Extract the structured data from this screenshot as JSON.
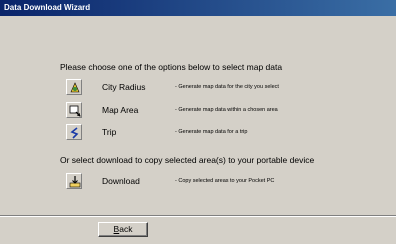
{
  "window": {
    "title": "Data Download Wizard"
  },
  "wizard": {
    "heading": "Please choose one of the options below to select map data",
    "options": [
      {
        "label": "City Radius",
        "description": "- Generate map data for the city you select",
        "icon": "city-radius-icon"
      },
      {
        "label": "Map Area",
        "description": "- Generate map data within a chosen area",
        "icon": "map-area-icon"
      },
      {
        "label": "Trip",
        "description": "- Generate map data for a trip",
        "icon": "trip-icon"
      }
    ],
    "download_heading": "Or select download to copy selected area(s) to your portable device",
    "download": {
      "label": "Download",
      "description": "- Copy selected areas to your Pocket PC",
      "icon": "download-icon"
    }
  },
  "footer": {
    "back_label_first": "B",
    "back_label_rest": "ack"
  },
  "colors": {
    "title_bar": "#0a246a",
    "window_bg": "#d4d0c8"
  }
}
